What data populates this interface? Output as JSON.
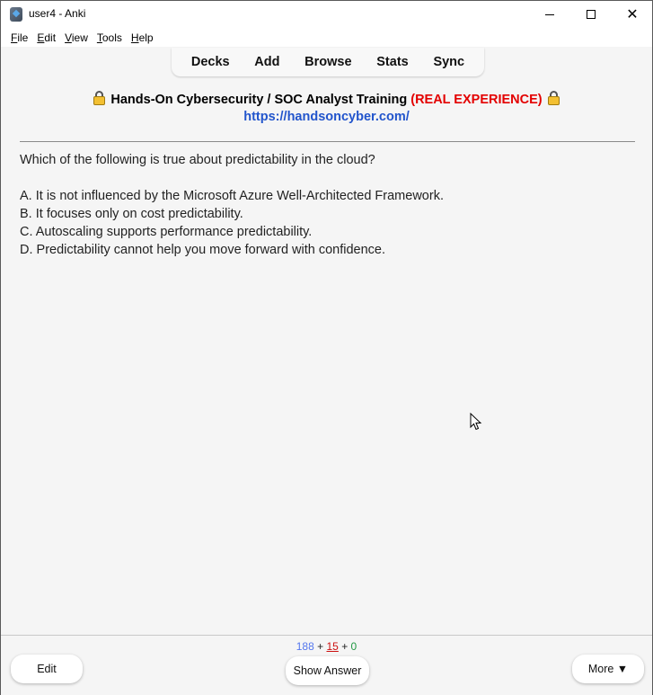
{
  "window": {
    "title": "user4 - Anki",
    "icon": "anki-app-icon",
    "controls": {
      "minimize_icon": "minimize-icon",
      "maximize_icon": "maximize-icon",
      "close_icon": "close-icon",
      "close_glyph": "✕"
    }
  },
  "menubar": {
    "items": [
      {
        "mnemonic": "F",
        "rest": "ile"
      },
      {
        "mnemonic": "E",
        "rest": "dit"
      },
      {
        "mnemonic": "V",
        "rest": "iew"
      },
      {
        "mnemonic": "T",
        "rest": "ools"
      },
      {
        "mnemonic": "H",
        "rest": "elp"
      }
    ]
  },
  "toolbar": {
    "items": [
      "Decks",
      "Add",
      "Browse",
      "Stats",
      "Sync"
    ]
  },
  "card": {
    "header_title": "Hands-On Cybersecurity / SOC Analyst Training",
    "header_highlight": "(REAL EXPERIENCE)",
    "header_icon": "lock-icon",
    "link": "https://handsoncyber.com/",
    "question": "Which of the following is true about predictability in the cloud?",
    "options": [
      "A. It is not influenced by the Microsoft Azure Well-Architected Framework.",
      "B. It focuses only on cost predictability.",
      "C. Autoscaling supports performance predictability.",
      "D. Predictability cannot help you move forward with confidence."
    ]
  },
  "bottombar": {
    "counts": {
      "new": "188",
      "learning": "15",
      "review": "0",
      "separator": "+"
    },
    "edit_label": "Edit",
    "show_answer_label": "Show Answer",
    "more_label": "More ▼"
  },
  "colors": {
    "accent_red": "#e30000",
    "link_blue": "#2255cc",
    "new_count": "#5577ee",
    "learn_count": "#cc1111",
    "review_count": "#229944"
  }
}
